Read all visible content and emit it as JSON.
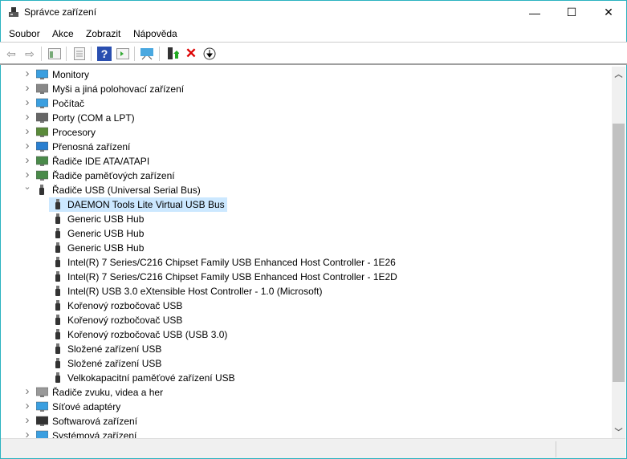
{
  "window": {
    "title": "Správce zařízení",
    "minimize": "—",
    "maximize": "☐",
    "close": "✕"
  },
  "menu": [
    "Soubor",
    "Akce",
    "Zobrazit",
    "Nápověda"
  ],
  "toolbar": [
    "back-icon",
    "forward-icon",
    "show-hide-console-tree-icon",
    "properties-icon",
    "help-icon",
    "action-pane-icon",
    "scan-hardware-icon",
    "update-driver-icon",
    "uninstall-icon",
    "disable-icon"
  ],
  "tree": {
    "categories_top": [
      {
        "label": "Monitory",
        "icon": "monitor-icon",
        "color": "#3b9fe0"
      },
      {
        "label": "Myši a jiná polohovací zařízení",
        "icon": "mouse-icon",
        "color": "#888"
      },
      {
        "label": "Počítač",
        "icon": "computer-icon",
        "color": "#3b9fe0"
      },
      {
        "label": "Porty (COM a LPT)",
        "icon": "port-icon",
        "color": "#666"
      },
      {
        "label": "Procesory",
        "icon": "processor-icon",
        "color": "#5a8a3a"
      },
      {
        "label": "Přenosná zařízení",
        "icon": "portable-device-icon",
        "color": "#2a7fd0"
      },
      {
        "label": "Řadiče IDE ATA/ATAPI",
        "icon": "ide-controller-icon",
        "color": "#4a8a4a"
      },
      {
        "label": "Řadiče paměťových zařízení",
        "icon": "storage-controller-icon",
        "color": "#4a8a4a"
      }
    ],
    "expanded": {
      "label": "Řadiče USB (Universal Serial Bus)",
      "icon": "usb-icon",
      "children": [
        "DAEMON Tools Lite Virtual USB Bus",
        "Generic USB Hub",
        "Generic USB Hub",
        "Generic USB Hub",
        "Intel(R) 7 Series/C216 Chipset Family USB Enhanced Host Controller - 1E26",
        "Intel(R) 7 Series/C216 Chipset Family USB Enhanced Host Controller - 1E2D",
        "Intel(R) USB 3.0 eXtensible Host Controller - 1.0 (Microsoft)",
        "Kořenový rozbočovač USB",
        "Kořenový rozbočovač USB",
        "Kořenový rozbočovač USB (USB 3.0)",
        "Složené zařízení USB",
        "Složené zařízení USB",
        "Velkokapacitní paměťové zařízení USB"
      ],
      "selected_index": 0
    },
    "categories_bottom": [
      {
        "label": "Řadiče zvuku, videa a her",
        "icon": "speaker-icon",
        "color": "#999"
      },
      {
        "label": "Síťové adaptéry",
        "icon": "network-adapter-icon",
        "color": "#3b9fe0"
      },
      {
        "label": "Softwarová zařízení",
        "icon": "software-device-icon",
        "color": "#333"
      },
      {
        "label": "Systémová zařízení",
        "icon": "system-device-icon",
        "color": "#3b9fe0"
      }
    ]
  },
  "colors": {
    "selection": "#cce8ff",
    "border": "#2bb3c0"
  }
}
